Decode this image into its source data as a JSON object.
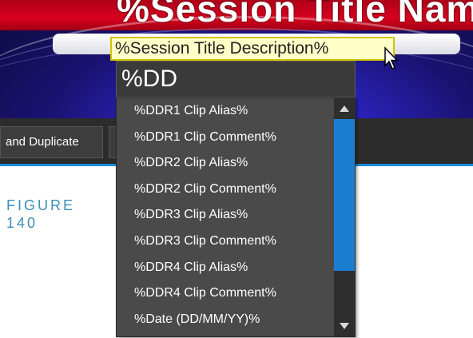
{
  "banner": {
    "title_text": "%Session Title Name",
    "description_value": "%Session Title Description%"
  },
  "autocomplete": {
    "input_value": "%DD"
  },
  "toolbar": {
    "button_label": "and Duplicate"
  },
  "caption": {
    "line1": "FIGURE",
    "line2": "140"
  },
  "dropdown": {
    "items": [
      "%DDR1 Clip Alias%",
      "%DDR1 Clip Comment%",
      "%DDR2 Clip Alias%",
      "%DDR2 Clip Comment%",
      "%DDR3 Clip Alias%",
      "%DDR3 Clip Comment%",
      "%DDR4 Clip Alias%",
      "%DDR4 Clip Comment%",
      "%Date (DD/MM/YY)%"
    ]
  },
  "colors": {
    "accent_blue": "#1a7dd0",
    "caption_blue": "#3a8fb8",
    "field_highlight": "#ffffc8",
    "title_red": "#d8001e"
  }
}
